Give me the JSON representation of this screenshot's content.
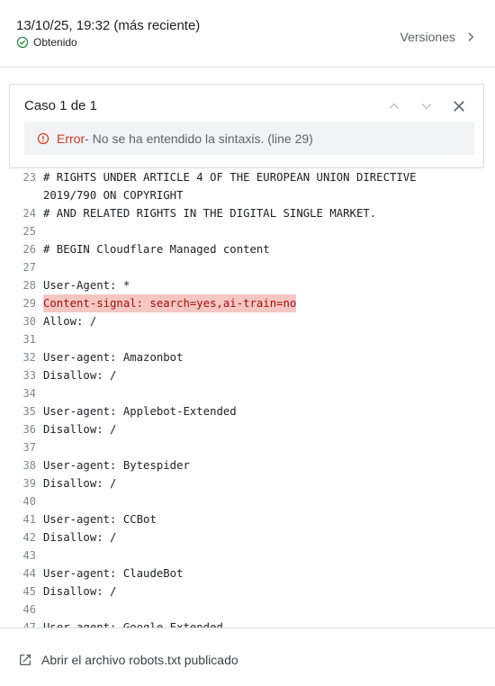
{
  "header": {
    "timestamp": "13/10/25, 19:32 (más reciente)",
    "status": "Obtenido",
    "versions_label": "Versiones"
  },
  "issue_panel": {
    "title": "Caso 1 de 1",
    "error_label": "Error",
    "error_message": " - No se ha entendido la sintaxis. (line 29)"
  },
  "code_lines": [
    {
      "n": "23",
      "t": "# RIGHTS UNDER ARTICLE 4 OF THE EUROPEAN UNION DIRECTIVE"
    },
    {
      "n": "",
      "t": "2019/790 ON COPYRIGHT"
    },
    {
      "n": "24",
      "t": "# AND RELATED RIGHTS IN THE DIGITAL SINGLE MARKET."
    },
    {
      "n": "25",
      "t": ""
    },
    {
      "n": "26",
      "t": "# BEGIN Cloudflare Managed content"
    },
    {
      "n": "27",
      "t": ""
    },
    {
      "n": "28",
      "t": "User-Agent: *"
    },
    {
      "n": "29",
      "t": "Content-signal: search=yes,ai-train=no",
      "error": true
    },
    {
      "n": "30",
      "t": "Allow: /"
    },
    {
      "n": "31",
      "t": ""
    },
    {
      "n": "32",
      "t": "User-agent: Amazonbot"
    },
    {
      "n": "33",
      "t": "Disallow: /"
    },
    {
      "n": "34",
      "t": ""
    },
    {
      "n": "35",
      "t": "User-agent: Applebot-Extended"
    },
    {
      "n": "36",
      "t": "Disallow: /"
    },
    {
      "n": "37",
      "t": ""
    },
    {
      "n": "38",
      "t": "User-agent: Bytespider"
    },
    {
      "n": "39",
      "t": "Disallow: /"
    },
    {
      "n": "40",
      "t": ""
    },
    {
      "n": "41",
      "t": "User-agent: CCBot"
    },
    {
      "n": "42",
      "t": "Disallow: /"
    },
    {
      "n": "43",
      "t": ""
    },
    {
      "n": "44",
      "t": "User-agent: ClaudeBot"
    },
    {
      "n": "45",
      "t": "Disallow: /"
    },
    {
      "n": "46",
      "t": ""
    },
    {
      "n": "47",
      "t": "User-agent: Google-Extended"
    }
  ],
  "footer": {
    "open_link": "Abrir el archivo robots.txt publicado"
  },
  "colors": {
    "success": "#188038",
    "error": "#d93025",
    "error_highlight": "#f4c7c3"
  },
  "icons": [
    "check-circle-icon",
    "chevron-right-icon",
    "chevron-up-icon",
    "chevron-down-icon",
    "close-icon",
    "error-icon",
    "open-in-new-icon"
  ]
}
